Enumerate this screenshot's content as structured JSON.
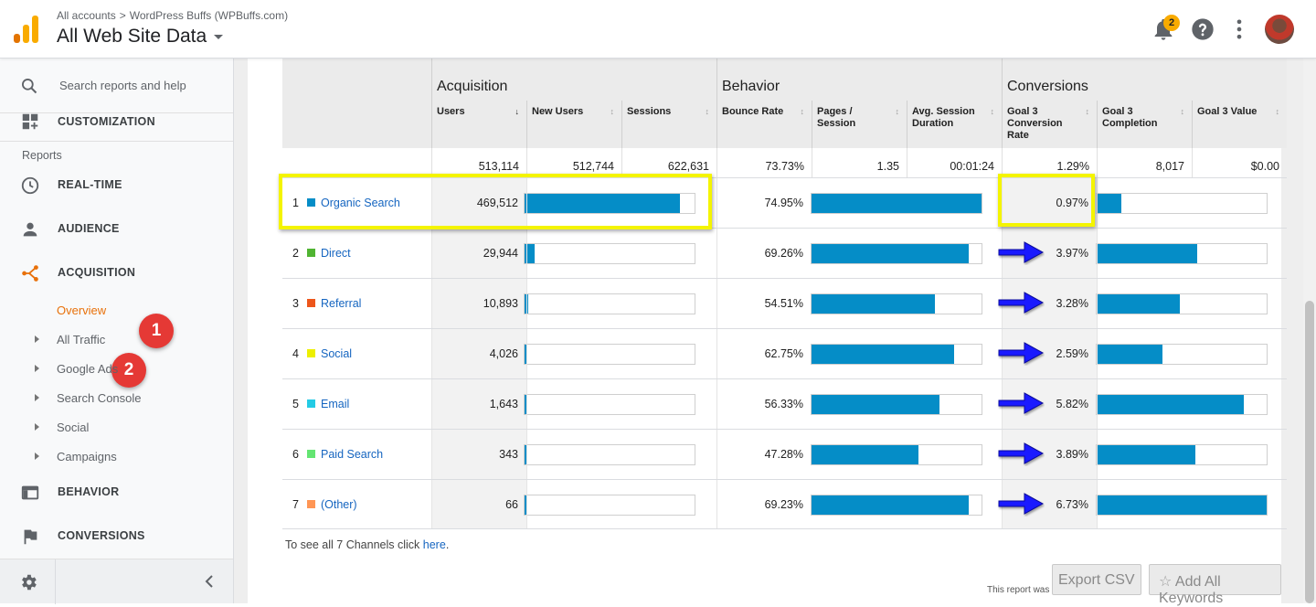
{
  "header": {
    "breadcrumb_root": "All accounts",
    "breadcrumb_account": "WordPress Buffs (WPBuffs.com)",
    "view_title": "All Web Site Data",
    "notification_count": "2"
  },
  "sidebar": {
    "search_placeholder": "Search reports and help",
    "customization": "CUSTOMIZATION",
    "reports_label": "Reports",
    "items": {
      "realtime": "REAL-TIME",
      "audience": "AUDIENCE",
      "acquisition": "ACQUISITION",
      "behavior": "BEHAVIOR",
      "conversions": "CONVERSIONS"
    },
    "sub": {
      "overview": "Overview",
      "all_traffic": "All Traffic",
      "google_ads": "Google Ads",
      "search_console": "Search Console",
      "social": "Social",
      "campaigns": "Campaigns"
    },
    "callouts": {
      "one": "1",
      "two": "2"
    }
  },
  "table": {
    "groups": {
      "acquisition": "Acquisition",
      "behavior": "Behavior",
      "conversions": "Conversions"
    },
    "columns": {
      "users": "Users",
      "new_users": "New Users",
      "sessions": "Sessions",
      "bounce_rate": "Bounce Rate",
      "pages_session": "Pages / Session",
      "avg_duration": "Avg. Session Duration",
      "goal_conv_rate": "Goal 3 Conversion Rate",
      "goal_completion": "Goal 3 Completion",
      "goal_value": "Goal 3 Value"
    },
    "totals": {
      "users": "513,114",
      "new_users": "512,744",
      "sessions": "622,631",
      "bounce_rate": "73.73%",
      "pages_session": "1.35",
      "avg_duration": "00:01:24",
      "goal_conv_rate": "1.29%",
      "goal_completion": "8,017",
      "goal_value": "$0.00"
    },
    "rows": [
      {
        "idx": "1",
        "name": "Organic Search",
        "color": "#058dc7",
        "users": "469,512",
        "users_pct": 0.915,
        "bounce": "74.95%",
        "bounce_pct": 1.0,
        "conv": "0.97%",
        "conv_pct": 0.144
      },
      {
        "idx": "2",
        "name": "Direct",
        "color": "#50b432",
        "users": "29,944",
        "users_pct": 0.058,
        "bounce": "69.26%",
        "bounce_pct": 0.924,
        "conv": "3.97%",
        "conv_pct": 0.59
      },
      {
        "idx": "3",
        "name": "Referral",
        "color": "#ed561b",
        "users": "10,893",
        "users_pct": 0.021,
        "bounce": "54.51%",
        "bounce_pct": 0.727,
        "conv": "3.28%",
        "conv_pct": 0.487
      },
      {
        "idx": "4",
        "name": "Social",
        "color": "#edef00",
        "users": "4,026",
        "users_pct": 0.008,
        "bounce": "62.75%",
        "bounce_pct": 0.837,
        "conv": "2.59%",
        "conv_pct": 0.385
      },
      {
        "idx": "5",
        "name": "Email",
        "color": "#24cbe5",
        "users": "1,643",
        "users_pct": 0.004,
        "bounce": "56.33%",
        "bounce_pct": 0.752,
        "conv": "5.82%",
        "conv_pct": 0.865
      },
      {
        "idx": "6",
        "name": "Paid Search",
        "color": "#64e572",
        "users": "343",
        "users_pct": 0.001,
        "bounce": "47.28%",
        "bounce_pct": 0.631,
        "conv": "3.89%",
        "conv_pct": 0.578
      },
      {
        "idx": "7",
        "name": "(Other)",
        "color": "#ff9655",
        "users": "66",
        "users_pct": 0.0002,
        "bounce": "69.23%",
        "bounce_pct": 0.924,
        "conv": "6.73%",
        "conv_pct": 1.0
      }
    ]
  },
  "footer": {
    "see_all_prefix": "To see all 7 Channels click",
    "see_all_link": "here",
    "export_csv": "Export CSV",
    "add_keywords": "Add All Keywords",
    "report_generated": "This report was ge"
  }
}
